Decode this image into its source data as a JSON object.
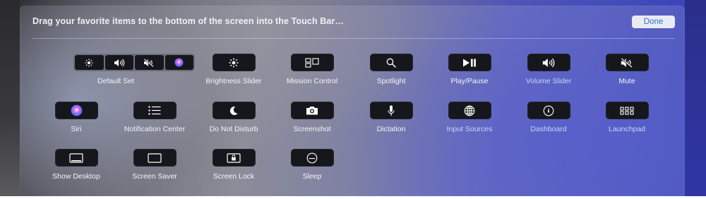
{
  "header": {
    "title": "Drag your favorite items to the bottom of the screen into the Touch Bar…",
    "done_label": "Done"
  },
  "colors": {
    "accent": "#2f6fd6",
    "tile": "#16171c",
    "label": "#f4f4f8",
    "label_blue": "#c9d4ff"
  },
  "items": {
    "default_set": {
      "label": "Default Set",
      "icons": [
        "brightness-icon",
        "volume-icon",
        "mute-icon",
        "siri-icon"
      ]
    },
    "brightness_slider": {
      "label": "Brightness Slider",
      "icon": "brightness-icon"
    },
    "mission_control": {
      "label": "Mission Control",
      "icon": "mission-control-icon"
    },
    "spotlight": {
      "label": "Spotlight",
      "icon": "search-icon"
    },
    "play_pause": {
      "label": "Play/Pause",
      "icon": "play-pause-icon"
    },
    "volume_slider": {
      "label": "Volume Slider",
      "icon": "volume-icon"
    },
    "mute": {
      "label": "Mute",
      "icon": "mute-icon"
    },
    "siri": {
      "label": "Siri",
      "icon": "siri-icon"
    },
    "notification_center": {
      "label": "Notification Center",
      "icon": "list-icon"
    },
    "do_not_disturb": {
      "label": "Do Not Disturb",
      "icon": "moon-icon"
    },
    "screenshot": {
      "label": "Screenshot",
      "icon": "camera-icon"
    },
    "dictation": {
      "label": "Dictation",
      "icon": "microphone-icon"
    },
    "input_sources": {
      "label": "Input Sources",
      "icon": "globe-icon"
    },
    "dashboard": {
      "label": "Dashboard",
      "icon": "dashboard-icon"
    },
    "launchpad": {
      "label": "Launchpad",
      "icon": "launchpad-icon"
    },
    "show_desktop": {
      "label": "Show Desktop",
      "icon": "show-desktop-icon"
    },
    "screen_saver": {
      "label": "Screen Saver",
      "icon": "screen-saver-icon"
    },
    "screen_lock": {
      "label": "Screen Lock",
      "icon": "lock-icon"
    },
    "sleep": {
      "label": "Sleep",
      "icon": "sleep-icon"
    }
  }
}
